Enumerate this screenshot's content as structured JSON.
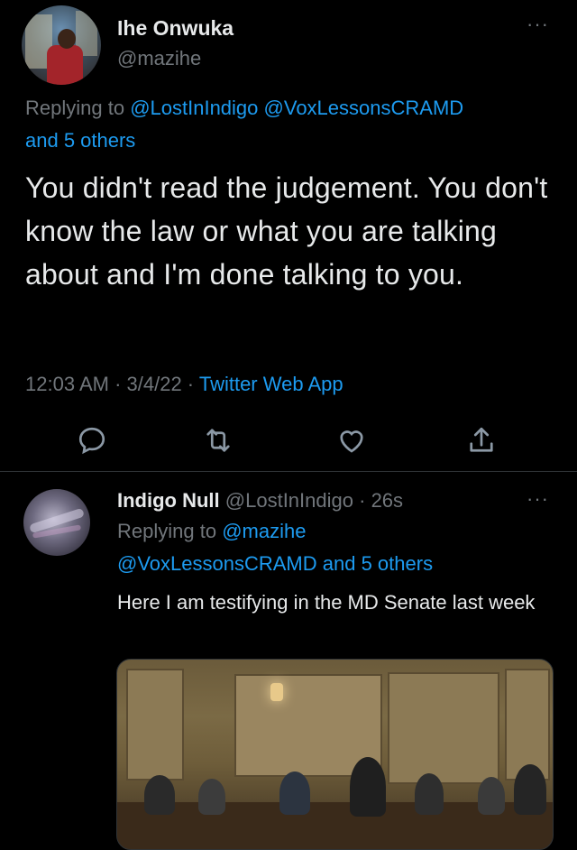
{
  "main_tweet": {
    "author_name": "Ihe Onwuka",
    "author_handle": "@mazihe",
    "replying_prefix": "Replying to ",
    "replying_to": [
      "@LostInIndigo",
      "@VoxLessonsCRAMD"
    ],
    "replying_others": "and 5 others",
    "text": "You didn't read the judgement. You don't know the law or what you are talking about and I'm done talking to you.",
    "time": "12:03 AM",
    "date": "3/4/22",
    "separator": " · ",
    "source": "Twitter Web App",
    "more_label": "···"
  },
  "reply_tweet": {
    "author_name": "Indigo Null",
    "author_handle": "@LostInIndigo",
    "separator": " · ",
    "age": "26s",
    "replying_prefix": "Replying to ",
    "replying_to": "@mazihe",
    "replying_line2_handle": "@VoxLessonsCRAMD",
    "replying_line2_others": " and 5 others",
    "text": "Here I am testifying in the MD Senate last week",
    "more_label": "···"
  },
  "actions": [
    "reply-icon",
    "retweet-icon",
    "like-icon",
    "share-icon"
  ],
  "colors": {
    "background": "#000000",
    "link": "#1d9bf0",
    "muted": "#71767b",
    "text": "#e7e9ea"
  }
}
